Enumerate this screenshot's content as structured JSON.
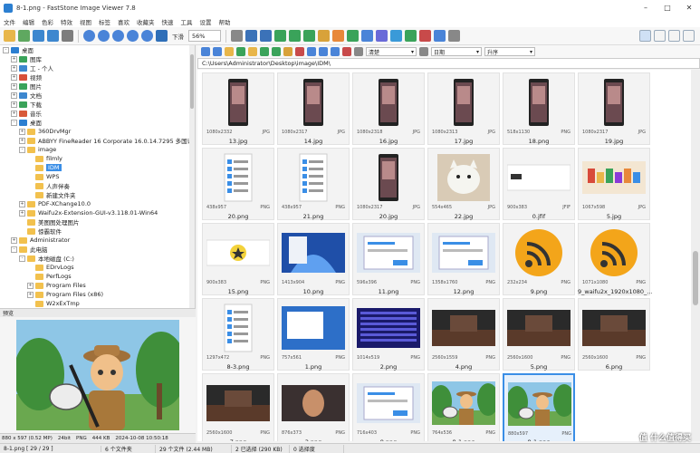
{
  "window": {
    "title": "8-1.png - FastStone Image Viewer 7.8"
  },
  "menu": [
    "文件",
    "编辑",
    "色彩",
    "特效",
    "视图",
    "标签",
    "喜欢",
    "收藏夹",
    "快速",
    "工具",
    "设置",
    "帮助"
  ],
  "toolbar": {
    "fit_label": "下滑",
    "zoom": "56%"
  },
  "tree": [
    {
      "label": "桌面",
      "indent": 0,
      "exp": "-"
    },
    {
      "label": "图库",
      "indent": 1,
      "exp": "+"
    },
    {
      "label": "工 - 个人",
      "indent": 1,
      "exp": "+"
    },
    {
      "label": "视频",
      "indent": 1,
      "exp": "+"
    },
    {
      "label": "图片",
      "indent": 1,
      "exp": "+"
    },
    {
      "label": "文档",
      "indent": 1,
      "exp": "+"
    },
    {
      "label": "下载",
      "indent": 1,
      "exp": "+"
    },
    {
      "label": "音乐",
      "indent": 1,
      "exp": "+"
    },
    {
      "label": "桌面",
      "indent": 1,
      "exp": "-"
    },
    {
      "label": "360DrvMgr",
      "indent": 2,
      "exp": "+"
    },
    {
      "label": "ABBYY FineReader 16 Corporate 16.0.14.7295 多国语言版",
      "indent": 2,
      "exp": "+"
    },
    {
      "label": "image",
      "indent": 2,
      "exp": "-"
    },
    {
      "label": "filmly",
      "indent": 3,
      "exp": ""
    },
    {
      "label": "IDM",
      "indent": 3,
      "exp": "",
      "sel": true
    },
    {
      "label": "WPS",
      "indent": 3,
      "exp": ""
    },
    {
      "label": "人声伴奏",
      "indent": 3,
      "exp": ""
    },
    {
      "label": "新建文件夹",
      "indent": 3,
      "exp": ""
    },
    {
      "label": "PDF-XChange10.0",
      "indent": 2,
      "exp": "+"
    },
    {
      "label": "Waifu2x-Extension-GUI-v3.118.01-Win64",
      "indent": 2,
      "exp": "+"
    },
    {
      "label": "美图图处理图片",
      "indent": 2,
      "exp": ""
    },
    {
      "label": "惊霸软件",
      "indent": 2,
      "exp": ""
    },
    {
      "label": "Administrator",
      "indent": 1,
      "exp": "+"
    },
    {
      "label": "此电脑",
      "indent": 1,
      "exp": "-"
    },
    {
      "label": "本地磁盘 (C:)",
      "indent": 2,
      "exp": "-"
    },
    {
      "label": "EDrvLogs",
      "indent": 3,
      "exp": ""
    },
    {
      "label": "PerfLogs",
      "indent": 3,
      "exp": ""
    },
    {
      "label": "Program Files",
      "indent": 3,
      "exp": "+"
    },
    {
      "label": "Program Files (x86)",
      "indent": 3,
      "exp": "+"
    },
    {
      "label": "W2xExTmp",
      "indent": 3,
      "exp": ""
    }
  ],
  "preview": {
    "header": "预览",
    "info": [
      "880 x 597 (0.52 MP)",
      "24bit",
      "PNG",
      "444 KB",
      "2024-10-08 10:50:18"
    ]
  },
  "right_toolbar": {
    "sort1": "清楚",
    "sort2": "日期",
    "sort3": "升序"
  },
  "path": "C:\\Users\\Administrator\\Desktop\\image\\IDM\\",
  "thumbs": [
    {
      "name": "13.jpg",
      "dims": "1080x2332",
      "fmt": "JPG",
      "kind": "phone"
    },
    {
      "name": "14.jpg",
      "dims": "1080x2317",
      "fmt": "JPG",
      "kind": "phone"
    },
    {
      "name": "16.jpg",
      "dims": "1080x2318",
      "fmt": "JPG",
      "kind": "phone"
    },
    {
      "name": "17.jpg",
      "dims": "1080x2313",
      "fmt": "JPG",
      "kind": "phone"
    },
    {
      "name": "18.png",
      "dims": "518x1130",
      "fmt": "PNG",
      "kind": "phone"
    },
    {
      "name": "19.jpg",
      "dims": "1080x2317",
      "fmt": "JPG",
      "kind": "phone"
    },
    {
      "name": "20.png",
      "dims": "438x957",
      "fmt": "PNG",
      "kind": "list"
    },
    {
      "name": "21.png",
      "dims": "438x957",
      "fmt": "PNG",
      "kind": "list"
    },
    {
      "name": "20.jpg",
      "dims": "1080x2317",
      "fmt": "JPG",
      "kind": "phone"
    },
    {
      "name": "22.jpg",
      "dims": "554x465",
      "fmt": "JPG",
      "kind": "cat"
    },
    {
      "name": "0.jfif",
      "dims": "900x383",
      "fmt": "JFIF",
      "kind": "banner"
    },
    {
      "name": "5.jpg",
      "dims": "1067x598",
      "fmt": "JPG",
      "kind": "food"
    },
    {
      "name": "15.png",
      "dims": "900x383",
      "fmt": "PNG",
      "kind": "star"
    },
    {
      "name": "10.png",
      "dims": "1413x904",
      "fmt": "PNG",
      "kind": "win11"
    },
    {
      "name": "11.png",
      "dims": "596x396",
      "fmt": "PNG",
      "kind": "dialog"
    },
    {
      "name": "12.png",
      "dims": "1358x1760",
      "fmt": "PNG",
      "kind": "dialog"
    },
    {
      "name": "9.png",
      "dims": "232x234",
      "fmt": "PNG",
      "kind": "rss"
    },
    {
      "name": "9_waifu2x_1920x1080_...",
      "dims": "1071x1080",
      "fmt": "PNG",
      "kind": "rss"
    },
    {
      "name": "8-3.png",
      "dims": "1297x472",
      "fmt": "PNG",
      "kind": "list"
    },
    {
      "name": "1.png",
      "dims": "757x561",
      "fmt": "PNG",
      "kind": "blue"
    },
    {
      "name": "2.png",
      "dims": "1014x519",
      "fmt": "PNG",
      "kind": "code"
    },
    {
      "name": "4.png",
      "dims": "2560x1559",
      "fmt": "PNG",
      "kind": "game"
    },
    {
      "name": "5.png",
      "dims": "2560x1600",
      "fmt": "PNG",
      "kind": "game"
    },
    {
      "name": "6.png",
      "dims": "2560x1600",
      "fmt": "PNG",
      "kind": "game"
    },
    {
      "name": "7.png",
      "dims": "2560x1600",
      "fmt": "PNG",
      "kind": "game"
    },
    {
      "name": "3.png",
      "dims": "876x373",
      "fmt": "PNG",
      "kind": "face"
    },
    {
      "name": "8.png",
      "dims": "716x403",
      "fmt": "PNG",
      "kind": "dialog"
    },
    {
      "name": "8-1.png",
      "dims": "764x536",
      "fmt": "PNG",
      "kind": "cartoon"
    },
    {
      "name": "8-1.png",
      "dims": "880x597",
      "fmt": "PNG",
      "kind": "cartoon",
      "sel": true
    }
  ],
  "status": [
    "8-1.png [ 29 / 29 ]",
    "6 个文件夹",
    "29 个文件 (2.44 MB)",
    "2 已选择 (290 KB)",
    "0 选择度"
  ],
  "watermark": "值 什么值得买"
}
